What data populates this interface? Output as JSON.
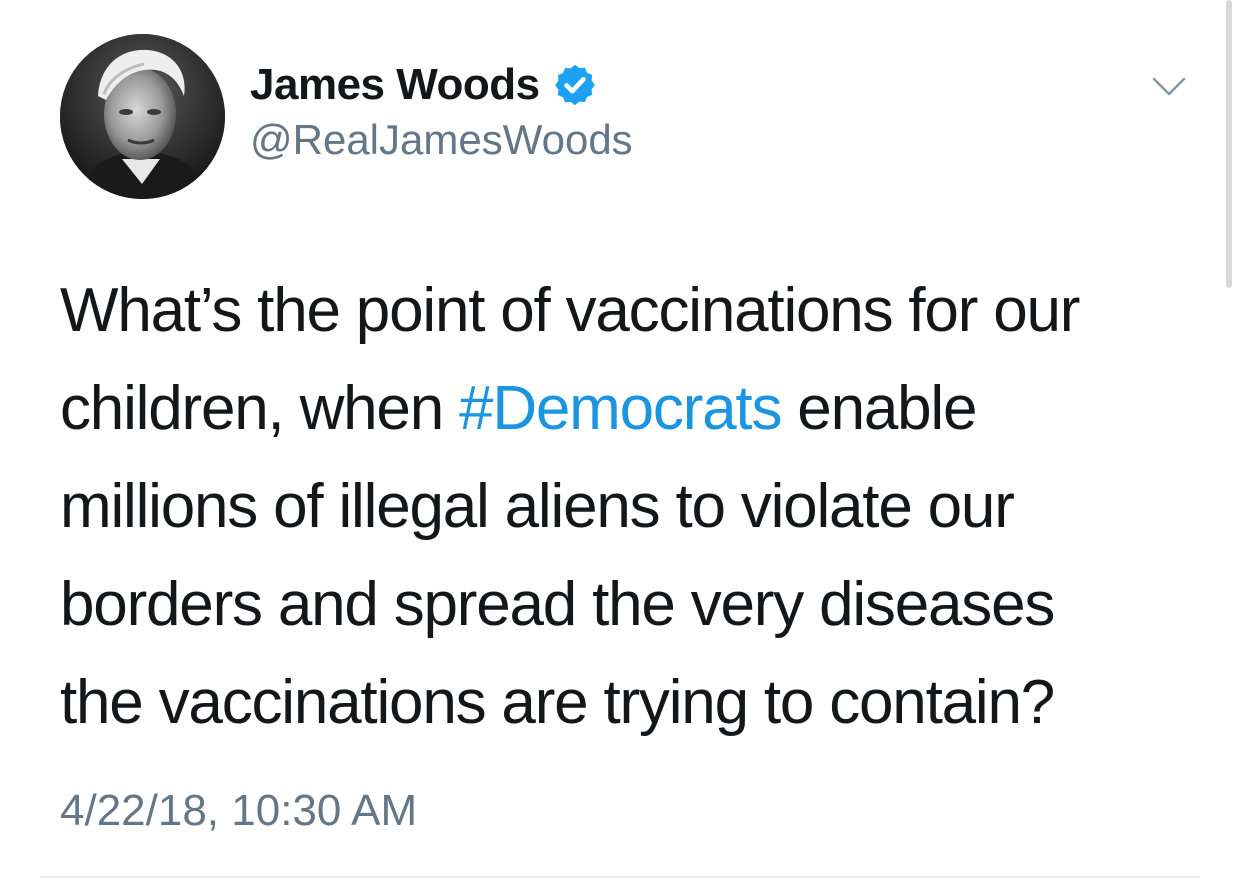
{
  "author": {
    "display_name": "James Woods",
    "handle": "@RealJamesWoods",
    "verified": true,
    "avatar_icon": "profile-photo",
    "verified_icon": "verified-badge-icon"
  },
  "menu": {
    "icon": "chevron-down-icon"
  },
  "tweet": {
    "lines": [
      {
        "text": "What’s the point of vaccinations for our"
      },
      {
        "before": "children, when ",
        "hashtag": "#Democrats",
        "after": " enable"
      },
      {
        "text": "millions of illegal aliens to violate our"
      },
      {
        "text": "borders and spread the very diseases"
      },
      {
        "text": "the vaccinations are trying to contain?"
      }
    ],
    "timestamp": "4/22/18, 10:30 AM"
  },
  "colors": {
    "text": "#14171a",
    "secondary": "#657786",
    "link": "#1b95e0",
    "verified": "#1da1f2",
    "divider": "#e6ecf0"
  }
}
